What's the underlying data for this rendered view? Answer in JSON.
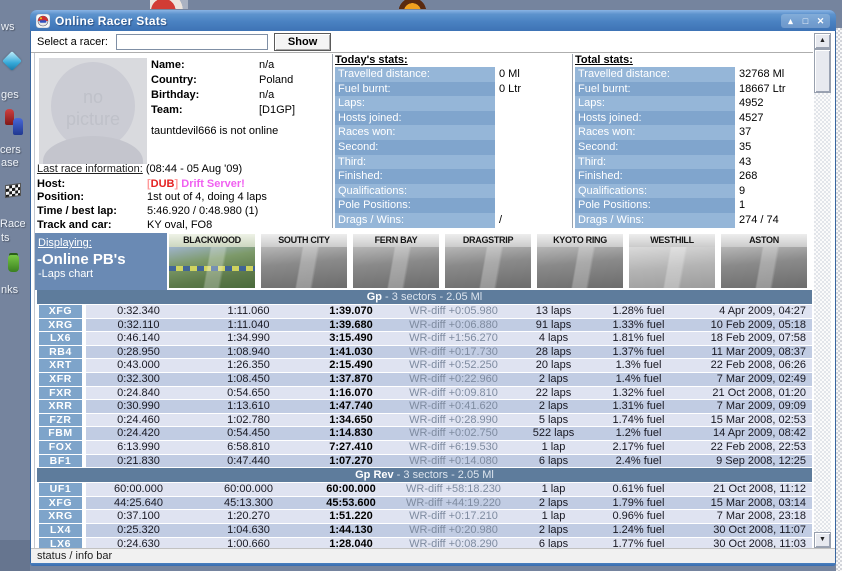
{
  "window": {
    "title": "Online Racer Stats",
    "controls": [
      {
        "name": "shade-button",
        "glyph": "▴"
      },
      {
        "name": "maximize-button",
        "glyph": "□"
      },
      {
        "name": "close-button",
        "glyph": "✕"
      }
    ]
  },
  "toolbar": {
    "select_label": "Select a racer:",
    "input_value": "",
    "show_button": "Show"
  },
  "profile": {
    "photo_text": "no picture",
    "fields": [
      {
        "label": "Name:",
        "value": "n/a"
      },
      {
        "label": "Country:",
        "value": "Poland"
      },
      {
        "label": "Birthday:",
        "value": "n/a"
      },
      {
        "label": "Team:",
        "value": "[D1GP]"
      }
    ],
    "status": "tauntdevil666 is not online"
  },
  "last_race": {
    "heading": "Last race information:",
    "timestamp": " (08:44 - 05 Aug '09)",
    "rows": [
      {
        "label": "Host:",
        "value_parts": [
          {
            "text": "[",
            "color": "#ff9a9a"
          },
          {
            "text": "DUB",
            "color": "#e42222"
          },
          {
            "text": "]",
            "color": "#ff9a9a"
          },
          {
            "text": " Drift Server!",
            "color": "#f060f0"
          }
        ]
      },
      {
        "label": "Position:",
        "value": "1st out of 4, doing 4 laps"
      },
      {
        "label": "Time / best lap:",
        "value": "5:46.920 / 0:48.980 (1)"
      },
      {
        "label": "Track and car:",
        "value": "KY oval, FO8"
      }
    ]
  },
  "today_stats": {
    "heading": "Today's stats:",
    "rows": [
      {
        "label": "Travelled distance:",
        "value": "0 Ml"
      },
      {
        "label": "Fuel burnt:",
        "value": "0 Ltr"
      },
      {
        "label": "Laps:",
        "value": ""
      },
      {
        "label": "Hosts joined:",
        "value": ""
      },
      {
        "label": "Races won:",
        "value": ""
      },
      {
        "label": "Second:",
        "value": ""
      },
      {
        "label": "Third:",
        "value": ""
      },
      {
        "label": "Finished:",
        "value": ""
      },
      {
        "label": "Qualifications:",
        "value": ""
      },
      {
        "label": "Pole Positions:",
        "value": ""
      },
      {
        "label": "Drags / Wins:",
        "value": "/"
      }
    ]
  },
  "total_stats": {
    "heading": "Total stats:",
    "rows": [
      {
        "label": "Travelled distance:",
        "value": "32768 Ml"
      },
      {
        "label": "Fuel burnt:",
        "value": "18667 Ltr"
      },
      {
        "label": "Laps:",
        "value": "4952"
      },
      {
        "label": "Hosts joined:",
        "value": "4527"
      },
      {
        "label": "Races won:",
        "value": "37"
      },
      {
        "label": "Second:",
        "value": "35"
      },
      {
        "label": "Third:",
        "value": "43"
      },
      {
        "label": "Finished:",
        "value": "268"
      },
      {
        "label": "Qualifications:",
        "value": "9"
      },
      {
        "label": "Pole Positions:",
        "value": "1"
      },
      {
        "label": "Drags / Wins:",
        "value": "274 / 74"
      }
    ]
  },
  "displaying": {
    "heading": "Displaying:",
    "lines": [
      "-Online PB's",
      "-Laps chart"
    ]
  },
  "tracks": [
    {
      "name": "BLACKWOOD",
      "selected": true
    },
    {
      "name": "SOUTH CITY"
    },
    {
      "name": "FERN BAY"
    },
    {
      "name": "DRAGSTRIP"
    },
    {
      "name": "KYOTO RING"
    },
    {
      "name": "WESTHILL",
      "faded": true
    },
    {
      "name": "ASTON"
    }
  ],
  "pb_tables": [
    {
      "title_bold": "Gp",
      "title_rest": " - 3 sectors - 2.05 Ml",
      "rows": [
        [
          "XFG",
          "0:32.340",
          "1:11.060",
          "1:39.070",
          "WR-diff +0:05.980",
          "13 laps",
          "1.28% fuel",
          "4 Apr 2009, 04:27"
        ],
        [
          "XRG",
          "0:32.110",
          "1:11.040",
          "1:39.680",
          "WR-diff +0:06.880",
          "91 laps",
          "1.33% fuel",
          "10 Feb 2009, 05:18"
        ],
        [
          "LX6",
          "0:46.140",
          "1:34.990",
          "3:15.490",
          "WR-diff +1:56.270",
          "4 laps",
          "1.81% fuel",
          "18 Feb 2009, 07:58"
        ],
        [
          "RB4",
          "0:28.950",
          "1:08.940",
          "1:41.030",
          "WR-diff +0:17.730",
          "28 laps",
          "1.37% fuel",
          "11 Mar 2009, 08:37"
        ],
        [
          "XRT",
          "0:43.000",
          "1:26.350",
          "2:15.490",
          "WR-diff +0:52.250",
          "20 laps",
          "1.3% fuel",
          "22 Feb 2008, 06:26"
        ],
        [
          "XFR",
          "0:32.300",
          "1:08.450",
          "1:37.870",
          "WR-diff +0:22.960",
          "2 laps",
          "1.4% fuel",
          "7 Mar 2009, 02:49"
        ],
        [
          "FXR",
          "0:24.840",
          "0:54.650",
          "1:16.070",
          "WR-diff +0:09.810",
          "22 laps",
          "1.32% fuel",
          "21 Oct 2008, 01:20"
        ],
        [
          "XRR",
          "0:30.990",
          "1:13.610",
          "1:47.740",
          "WR-diff +0:41.620",
          "2 laps",
          "1.31% fuel",
          "7 Mar 2009, 09:09"
        ],
        [
          "FZR",
          "0:24.460",
          "1:02.780",
          "1:34.650",
          "WR-diff +0:28.990",
          "5 laps",
          "1.74% fuel",
          "15 Mar 2008, 02:53"
        ],
        [
          "FBM",
          "0:24.420",
          "0:54.450",
          "1:14.830",
          "WR-diff +0:02.750",
          "522 laps",
          "1.2% fuel",
          "14 Apr 2009, 08:42"
        ],
        [
          "FOX",
          "6:13.990",
          "6:58.810",
          "7:27.410",
          "WR-diff +6:19.530",
          "1 lap",
          "2.17% fuel",
          "22 Feb 2008, 22:53"
        ],
        [
          "BF1",
          "0:21.830",
          "0:47.440",
          "1:07.270",
          "WR-diff +0:14.080",
          "6 laps",
          "2.4% fuel",
          "9 Sep 2008, 12:25"
        ]
      ]
    },
    {
      "title_bold": "Gp Rev",
      "title_rest": " - 3 sectors - 2.05 Ml",
      "rows": [
        [
          "UF1",
          "60:00.000",
          "60:00.000",
          "60:00.000",
          "WR-diff +58:18.230",
          "1 lap",
          "0.61% fuel",
          "21 Oct 2008, 11:12"
        ],
        [
          "XFG",
          "44:25.640",
          "45:13.300",
          "45:53.600",
          "WR-diff +44:19.220",
          "2 laps",
          "1.79% fuel",
          "15 Mar 2008, 03:14"
        ],
        [
          "XRG",
          "0:37.100",
          "1:20.270",
          "1:51.220",
          "WR-diff +0:17.210",
          "1 lap",
          "0.96% fuel",
          "7 Mar 2008, 23:18"
        ],
        [
          "LX4",
          "0:25.320",
          "1:04.630",
          "1:44.130",
          "WR-diff +0:20.980",
          "2 laps",
          "1.24% fuel",
          "30 Oct 2008, 11:07"
        ],
        [
          "LX6",
          "0:24.630",
          "1:00.660",
          "1:28.040",
          "WR-diff +0:08.290",
          "6 laps",
          "1.77% fuel",
          "30 Oct 2008, 11:03"
        ]
      ]
    }
  ],
  "scrollbar": {
    "up_glyph": "▲",
    "down_glyph": "▼"
  },
  "status_bar": "status / info bar",
  "desktop": {
    "labels": [
      "ws",
      "ges",
      "cers",
      "ase",
      "Race",
      "ts",
      "nks"
    ]
  },
  "colors": {
    "titlebar": "#4a82c2",
    "section_header": "#5e7c9c",
    "row_light": "#dfe3f1",
    "row_dark": "#c1cce3",
    "car_cell": "#7ea4ca",
    "stat_band_light": "#95b6d8",
    "stat_band_dark": "#80a5cd",
    "displaying_box": "#6a8ab4",
    "host_red": "#e42222",
    "host_magenta": "#f060f0"
  }
}
